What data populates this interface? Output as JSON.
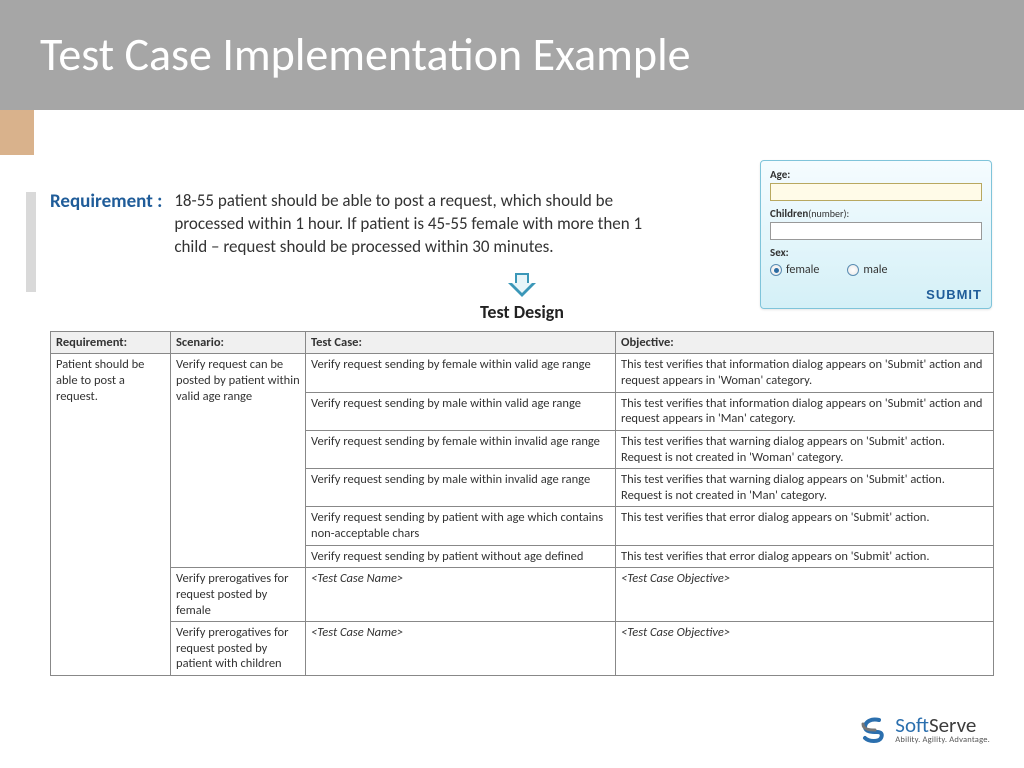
{
  "header": {
    "title": "Test Case Implementation Example"
  },
  "requirement": {
    "label": "Requirement :",
    "text": "18-55 patient should be able to post a request, which should be processed within 1 hour. If patient is 45-55 female with more then 1 child – request should be processed within 30 minutes."
  },
  "form": {
    "age_label": "Age:",
    "age_value": "",
    "children_label": "Children",
    "children_sub": "(number):",
    "children_value": "",
    "sex_label": "Sex:",
    "female": "female",
    "male": "male",
    "submit": "SUBMIT"
  },
  "test_design_title": "Test Design",
  "table": {
    "headers": {
      "requirement": "Requirement:",
      "scenario": "Scenario:",
      "testcase": "Test Case:",
      "objective": "Objective:"
    },
    "req1": "Patient should be able to post a request.",
    "scn1": "Verify request can be posted by patient within valid age range",
    "scn2": "Verify prerogatives for request posted by female",
    "scn3": "Verify prerogatives for request posted by patient with children",
    "tc1": "Verify request sending by female within valid age range",
    "ob1": "This test verifies that information dialog appears on 'Submit' action and request appears in 'Woman' category.",
    "tc2": "Verify request sending by male within valid age range",
    "ob2": "This test verifies that information dialog appears on 'Submit' action and request appears in 'Man' category.",
    "tc3": "Verify request sending by female within invalid age range",
    "ob3": "This test verifies that warning dialog appears on 'Submit' action. Request is not created in 'Woman' category.",
    "tc4": "Verify request sending by male within invalid age range",
    "ob4": "This test verifies that warning dialog appears on 'Submit' action. Request is not created in 'Man' category.",
    "tc5": "Verify request sending by patient with age which contains non-acceptable chars",
    "ob5": "This test verifies that error dialog appears on 'Submit' action.",
    "tc6": "Verify request sending by patient without age defined",
    "ob6": "This test verifies that error dialog appears on 'Submit' action.",
    "tc_ph": "<Test Case Name>",
    "ob_ph": "<Test Case Objective>"
  },
  "logo": {
    "brand1": "Soft",
    "brand2": "Serve",
    "tag": "Ability. Agility. Advantage."
  }
}
